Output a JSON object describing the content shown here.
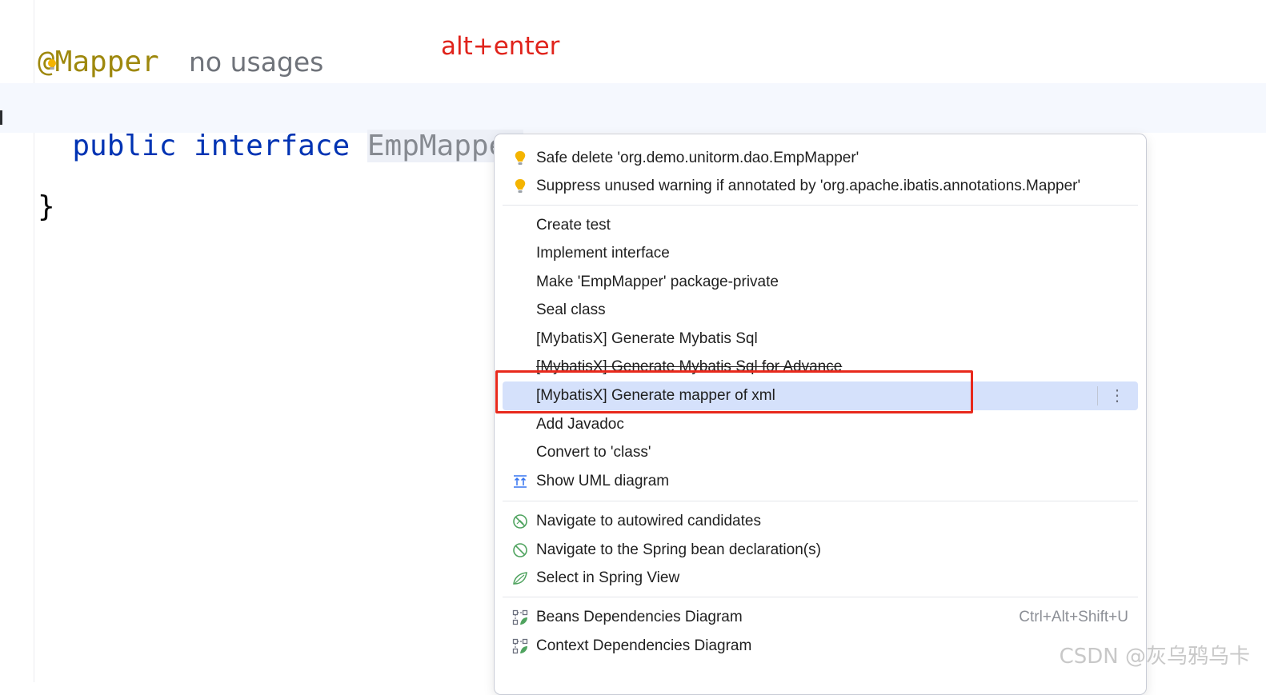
{
  "colors": {
    "keyword": "#0033b3",
    "annotation": "#9e880d",
    "hint_red": "#e0231b",
    "selection": "#d5e1fb",
    "bulb": "#f4b400",
    "spring_green": "#4fa35f"
  },
  "editor": {
    "annotation": "@Mapper",
    "usages_hint": "no usages",
    "kw_public": "public",
    "kw_interface": "interface",
    "class_name": "EmpMapper",
    "open_brace": "{",
    "close_brace": "}"
  },
  "hint": "alt+enter",
  "popup": {
    "items": [
      {
        "label": "Safe delete 'org.demo.unitorm.dao.EmpMapper'",
        "icon": "bulb-icon"
      },
      {
        "label": "Suppress unused warning if annotated by 'org.apache.ibatis.annotations.Mapper'",
        "icon": "bulb-icon"
      },
      {
        "label": "Create test"
      },
      {
        "label": "Implement interface"
      },
      {
        "label": "Make 'EmpMapper' package-private"
      },
      {
        "label": "Seal class"
      },
      {
        "label": "[MybatisX] Generate Mybatis Sql"
      },
      {
        "label": "[MybatisX] Generate Mybatis Sql for Advance"
      },
      {
        "label": "[MybatisX] Generate mapper of xml",
        "selected": true
      },
      {
        "label": "Add Javadoc"
      },
      {
        "label": "Convert to 'class'"
      },
      {
        "label": "Show UML diagram",
        "icon": "uml-diagram-icon"
      },
      {
        "label": "Navigate to autowired candidates",
        "icon": "autowired-icon"
      },
      {
        "label": "Navigate to the Spring bean declaration(s)",
        "icon": "spring-bean-icon"
      },
      {
        "label": "Select in Spring View",
        "icon": "spring-leaf-icon"
      },
      {
        "label": "Beans Dependencies Diagram",
        "icon": "beans-diagram-icon",
        "shortcut": "Ctrl+Alt+Shift+U"
      },
      {
        "label": "Context Dependencies Diagram",
        "icon": "context-diagram-icon"
      }
    ]
  },
  "watermark": "CSDN @灰乌鸦乌卡"
}
